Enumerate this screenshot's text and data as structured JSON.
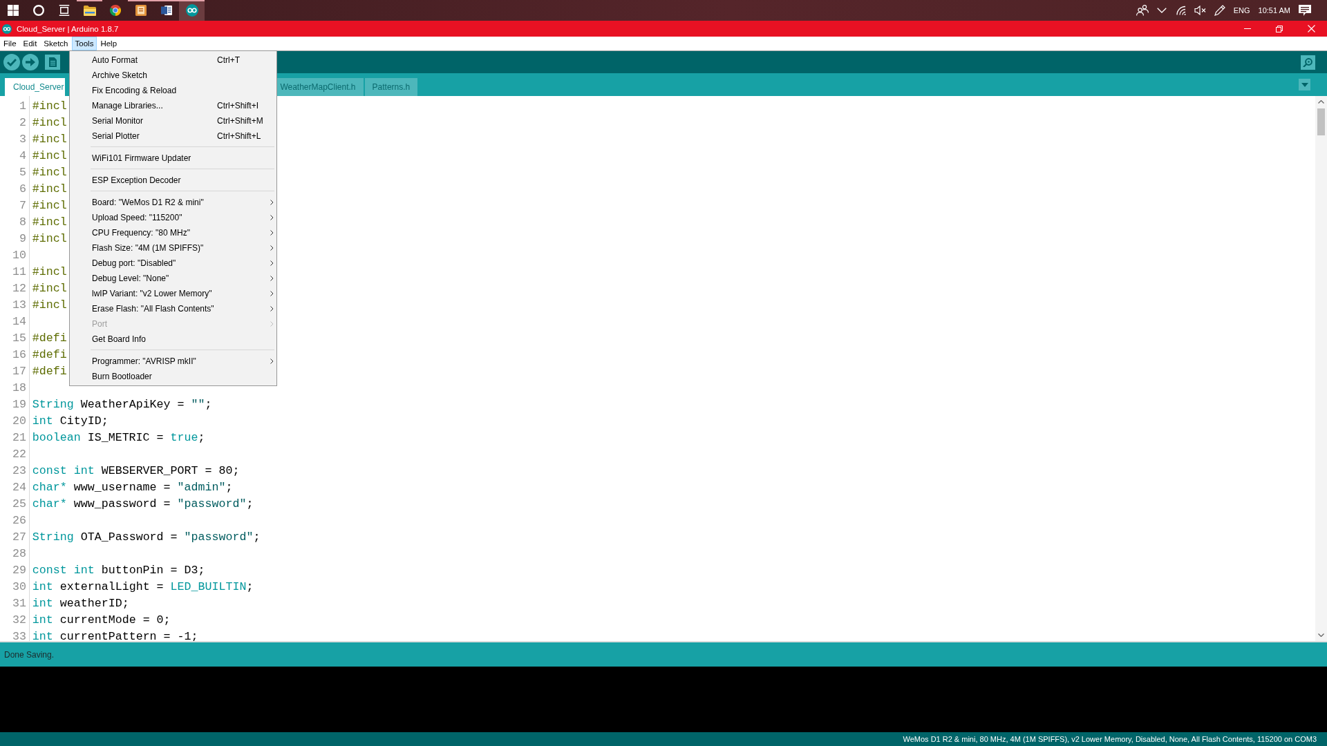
{
  "taskbar": {
    "apps": [
      {
        "kind": "folder",
        "running": true,
        "active": false
      },
      {
        "kind": "browser",
        "running": false,
        "active": false
      },
      {
        "kind": "tile",
        "running": true,
        "active": false
      },
      {
        "kind": "document",
        "running": true,
        "active": false
      },
      {
        "kind": "infinity",
        "running": true,
        "active": true
      }
    ],
    "language": "ENG",
    "time": "10:51 AM"
  },
  "window": {
    "title": "Cloud_Server | Arduino 1.8.7"
  },
  "menu_bar": [
    {
      "label": "File",
      "selected": false
    },
    {
      "label": "Edit",
      "selected": false
    },
    {
      "label": "Sketch",
      "selected": false
    },
    {
      "label": "Tools",
      "selected": true
    },
    {
      "label": "Help",
      "selected": false
    }
  ],
  "tools_menu": {
    "groups": [
      {
        "items": [
          {
            "label": "Auto Format",
            "shortcut": "Ctrl+T",
            "submenu": false,
            "disabled": false
          },
          {
            "label": "Archive Sketch",
            "submenu": false,
            "disabled": false
          },
          {
            "label": "Fix Encoding & Reload",
            "submenu": false,
            "disabled": false
          },
          {
            "label": "Manage Libraries...",
            "shortcut": "Ctrl+Shift+I",
            "submenu": false,
            "disabled": false
          },
          {
            "label": "Serial Monitor",
            "shortcut": "Ctrl+Shift+M",
            "submenu": false,
            "disabled": false
          },
          {
            "label": "Serial Plotter",
            "shortcut": "Ctrl+Shift+L",
            "submenu": false,
            "disabled": false
          }
        ]
      },
      {
        "items": [
          {
            "label": "WiFi101 Firmware Updater",
            "submenu": false,
            "disabled": false
          }
        ]
      },
      {
        "items": [
          {
            "label": "ESP Exception Decoder",
            "submenu": false,
            "disabled": false
          }
        ]
      },
      {
        "items": [
          {
            "label": "Board: \"WeMos D1 R2 & mini\"",
            "submenu": true,
            "disabled": false
          },
          {
            "label": "Upload Speed: \"115200\"",
            "submenu": true,
            "disabled": false
          },
          {
            "label": "CPU Frequency: \"80 MHz\"",
            "submenu": true,
            "disabled": false
          },
          {
            "label": "Flash Size: \"4M (1M SPIFFS)\"",
            "submenu": true,
            "disabled": false
          },
          {
            "label": "Debug port: \"Disabled\"",
            "submenu": true,
            "disabled": false
          },
          {
            "label": "Debug Level: \"None\"",
            "submenu": true,
            "disabled": false
          },
          {
            "label": "lwIP Variant: \"v2 Lower Memory\"",
            "submenu": true,
            "disabled": false
          },
          {
            "label": "Erase Flash: \"All Flash Contents\"",
            "submenu": true,
            "disabled": false
          },
          {
            "label": "Port",
            "submenu": true,
            "disabled": true
          },
          {
            "label": "Get Board Info",
            "submenu": false,
            "disabled": false
          }
        ]
      },
      {
        "items": [
          {
            "label": "Programmer: \"AVRISP mkII\"",
            "submenu": true,
            "disabled": false
          },
          {
            "label": "Burn Bootloader",
            "submenu": false,
            "disabled": false
          }
        ]
      }
    ]
  },
  "tabs": [
    {
      "label": "Cloud_Server",
      "selected": true
    },
    {
      "label": "WeatherMapClient.h",
      "selected": false
    },
    {
      "label": "Patterns.h",
      "selected": false
    }
  ],
  "editor": {
    "lines": [
      {
        "number": "1",
        "tokens": [
          {
            "kind": "directive",
            "text": "#incl"
          }
        ]
      },
      {
        "number": "2",
        "tokens": [
          {
            "kind": "directive",
            "text": "#incl"
          }
        ]
      },
      {
        "number": "3",
        "tokens": [
          {
            "kind": "directive",
            "text": "#incl"
          }
        ]
      },
      {
        "number": "4",
        "tokens": [
          {
            "kind": "directive",
            "text": "#incl"
          }
        ]
      },
      {
        "number": "5",
        "tokens": [
          {
            "kind": "directive",
            "text": "#incl"
          }
        ]
      },
      {
        "number": "6",
        "tokens": [
          {
            "kind": "directive",
            "text": "#incl"
          }
        ]
      },
      {
        "number": "7",
        "tokens": [
          {
            "kind": "directive",
            "text": "#incl"
          }
        ]
      },
      {
        "number": "8",
        "tokens": [
          {
            "kind": "directive",
            "text": "#incl"
          }
        ]
      },
      {
        "number": "9",
        "tokens": [
          {
            "kind": "directive",
            "text": "#incl"
          }
        ]
      },
      {
        "number": "10"
      },
      {
        "number": "11",
        "tokens": [
          {
            "kind": "directive",
            "text": "#incl"
          }
        ]
      },
      {
        "number": "12",
        "tokens": [
          {
            "kind": "directive",
            "text": "#incl"
          }
        ]
      },
      {
        "number": "13",
        "tokens": [
          {
            "kind": "directive",
            "text": "#incl"
          }
        ]
      },
      {
        "number": "14"
      },
      {
        "number": "15",
        "tokens": [
          {
            "kind": "directive",
            "text": "#defi"
          }
        ]
      },
      {
        "number": "16",
        "tokens": [
          {
            "kind": "directive",
            "text": "#defi"
          }
        ]
      },
      {
        "number": "17",
        "tokens": [
          {
            "kind": "directive",
            "text": "#defi"
          }
        ]
      },
      {
        "number": "18"
      },
      {
        "number": "19",
        "tokens": [
          {
            "kind": "keyword",
            "text": "String"
          },
          {
            "kind": "plain",
            "text": " WeatherApiKey = "
          },
          {
            "kind": "string",
            "text": "\"\""
          },
          {
            "kind": "plain",
            "text": ";"
          }
        ]
      },
      {
        "number": "20",
        "tokens": [
          {
            "kind": "keyword",
            "text": "int"
          },
          {
            "kind": "plain",
            "text": " CityID;"
          }
        ]
      },
      {
        "number": "21",
        "tokens": [
          {
            "kind": "keyword",
            "text": "boolean"
          },
          {
            "kind": "plain",
            "text": " IS_METRIC = "
          },
          {
            "kind": "keyword",
            "text": "true"
          },
          {
            "kind": "plain",
            "text": ";"
          }
        ]
      },
      {
        "number": "22"
      },
      {
        "number": "23",
        "tokens": [
          {
            "kind": "keyword",
            "text": "const int"
          },
          {
            "kind": "plain",
            "text": " WEBSERVER_PORT = 80;"
          }
        ]
      },
      {
        "number": "24",
        "tokens": [
          {
            "kind": "keyword",
            "text": "char*"
          },
          {
            "kind": "plain",
            "text": " www_username = "
          },
          {
            "kind": "string",
            "text": "\"admin\""
          },
          {
            "kind": "plain",
            "text": ";"
          }
        ]
      },
      {
        "number": "25",
        "tokens": [
          {
            "kind": "keyword",
            "text": "char*"
          },
          {
            "kind": "plain",
            "text": " www_password = "
          },
          {
            "kind": "string",
            "text": "\"password\""
          },
          {
            "kind": "plain",
            "text": ";"
          }
        ]
      },
      {
        "number": "26"
      },
      {
        "number": "27",
        "tokens": [
          {
            "kind": "keyword",
            "text": "String"
          },
          {
            "kind": "plain",
            "text": " OTA_Password = "
          },
          {
            "kind": "string",
            "text": "\"password\""
          },
          {
            "kind": "plain",
            "text": ";"
          }
        ]
      },
      {
        "number": "28"
      },
      {
        "number": "29",
        "tokens": [
          {
            "kind": "keyword",
            "text": "const int"
          },
          {
            "kind": "plain",
            "text": " buttonPin = D3;"
          }
        ]
      },
      {
        "number": "30",
        "tokens": [
          {
            "kind": "keyword",
            "text": "int"
          },
          {
            "kind": "plain",
            "text": " externalLight = "
          },
          {
            "kind": "keyword",
            "text": "LED_BUILTIN"
          },
          {
            "kind": "plain",
            "text": ";"
          }
        ]
      },
      {
        "number": "31",
        "tokens": [
          {
            "kind": "keyword",
            "text": "int"
          },
          {
            "kind": "plain",
            "text": " weatherID;"
          }
        ]
      },
      {
        "number": "32",
        "tokens": [
          {
            "kind": "keyword",
            "text": "int"
          },
          {
            "kind": "plain",
            "text": " currentMode = 0;"
          }
        ]
      },
      {
        "number": "33",
        "tokens": [
          {
            "kind": "keyword",
            "text": "int"
          },
          {
            "kind": "plain",
            "text": " currentPattern = -1;"
          }
        ]
      }
    ]
  },
  "message_bar": {
    "text": "Done Saving."
  },
  "status_bar": {
    "text": "WeMos D1 R2 & mini, 80 MHz, 4M (1M SPIFFS), v2 Lower Memory, Disabled, None, All Flash Contents, 115200 on COM3"
  }
}
